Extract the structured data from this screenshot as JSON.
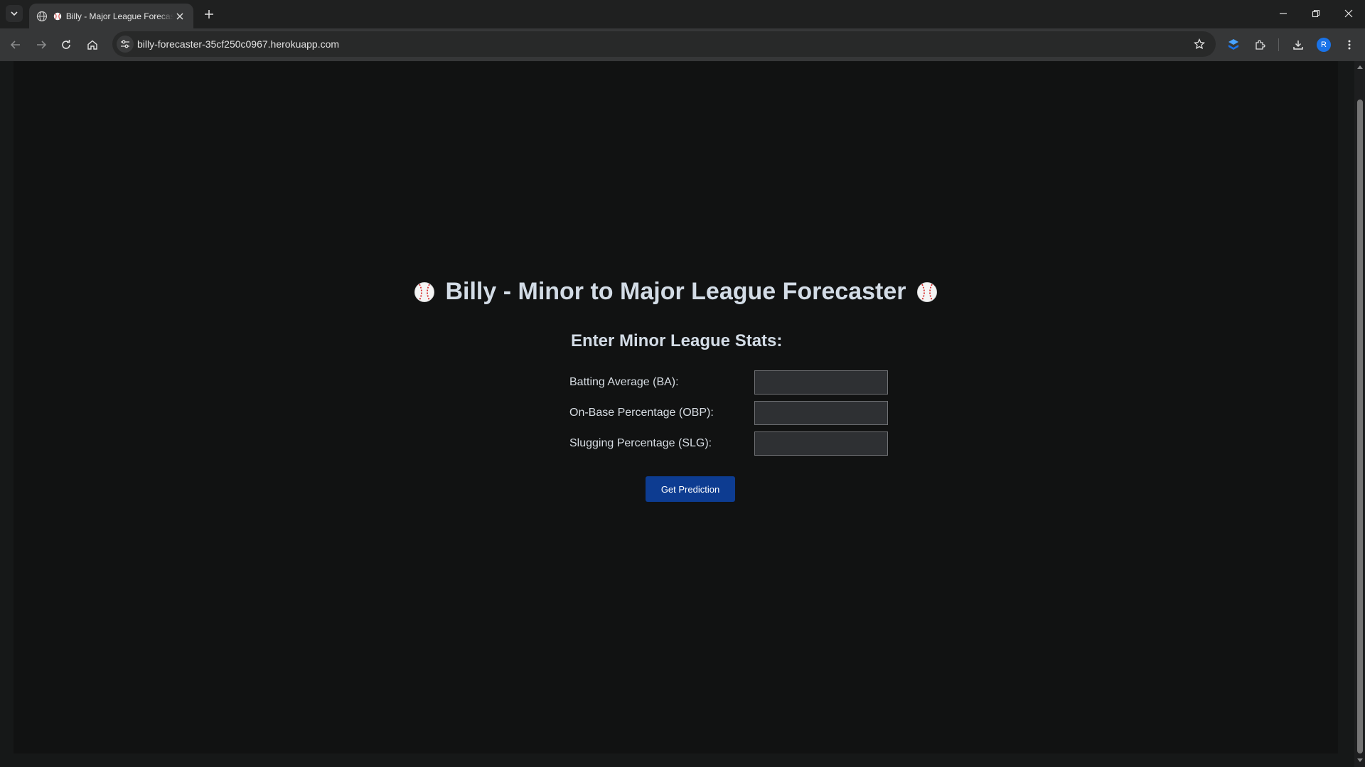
{
  "browser": {
    "tab": {
      "title": "Billy - Major League Forecaster"
    },
    "url": "billy-forecaster-35cf250c0967.herokuapp.com",
    "avatar_initial": "R"
  },
  "page": {
    "title": "Billy - Minor to Major League Forecaster",
    "form_heading": "Enter Minor League Stats:",
    "fields": [
      {
        "label": "Batting Average (BA):",
        "value": ""
      },
      {
        "label": "On-Base Percentage (OBP):",
        "value": ""
      },
      {
        "label": "Slugging Percentage (SLG):",
        "value": ""
      }
    ],
    "submit_label": "Get Prediction"
  },
  "colors": {
    "page_background": "#111212",
    "heading_text": "#d3dce6",
    "button_primary": "#0d3c91"
  },
  "icons": [
    "tab-search-icon",
    "globe-icon",
    "close-icon",
    "plus-icon",
    "minimize-icon",
    "restore-icon",
    "back-icon",
    "forward-icon",
    "reload-icon",
    "home-icon",
    "site-settings-icon",
    "star-icon",
    "extension-icon",
    "puzzle-icon",
    "download-icon",
    "menu-icon",
    "baseball-icon"
  ]
}
